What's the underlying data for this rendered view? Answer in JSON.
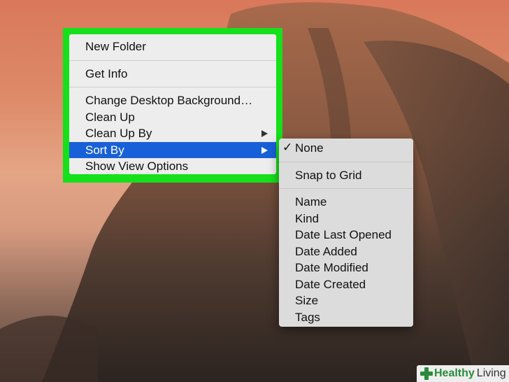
{
  "context_menu": {
    "items": [
      {
        "label": "New Folder"
      },
      {
        "label": "Get Info"
      },
      {
        "label": "Change Desktop Background…"
      },
      {
        "label": "Clean Up"
      },
      {
        "label": "Clean Up By"
      },
      {
        "label": "Sort By"
      },
      {
        "label": "Show View Options"
      }
    ]
  },
  "sort_submenu": {
    "items": [
      {
        "label": "None",
        "checked": true
      },
      {
        "label": "Snap to Grid"
      },
      {
        "label": "Name"
      },
      {
        "label": "Kind"
      },
      {
        "label": "Date Last Opened"
      },
      {
        "label": "Date Added"
      },
      {
        "label": "Date Modified"
      },
      {
        "label": "Date Created"
      },
      {
        "label": "Size"
      },
      {
        "label": "Tags"
      }
    ],
    "check_glyph": "✓"
  },
  "watermark": {
    "brand_bold": "Healthy",
    "brand_text": "Living"
  },
  "colors": {
    "highlight": "#16e01b",
    "selection": "#1860d8"
  }
}
